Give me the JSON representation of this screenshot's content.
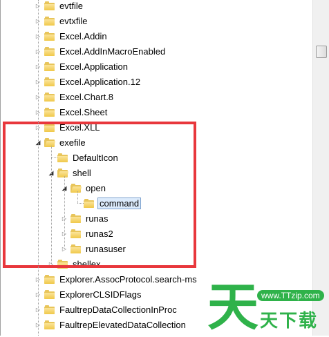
{
  "tree": {
    "items": [
      {
        "label": "evtfile",
        "level": 0,
        "state": "collapsed"
      },
      {
        "label": "evtxfile",
        "level": 0,
        "state": "collapsed"
      },
      {
        "label": "Excel.Addin",
        "level": 0,
        "state": "collapsed"
      },
      {
        "label": "Excel.AddInMacroEnabled",
        "level": 0,
        "state": "collapsed"
      },
      {
        "label": "Excel.Application",
        "level": 0,
        "state": "collapsed"
      },
      {
        "label": "Excel.Application.12",
        "level": 0,
        "state": "collapsed"
      },
      {
        "label": "Excel.Chart.8",
        "level": 0,
        "state": "collapsed"
      },
      {
        "label": "Excel.Sheet",
        "level": 0,
        "state": "collapsed"
      },
      {
        "label": "Excel.XLL",
        "level": 0,
        "state": "collapsed"
      },
      {
        "label": "exefile",
        "level": 0,
        "state": "expanded"
      },
      {
        "label": "DefaultIcon",
        "level": 1,
        "state": "leaf"
      },
      {
        "label": "shell",
        "level": 1,
        "state": "expanded"
      },
      {
        "label": "open",
        "level": 2,
        "state": "expanded"
      },
      {
        "label": "command",
        "level": 3,
        "state": "leaf",
        "selected": true
      },
      {
        "label": "runas",
        "level": 2,
        "state": "collapsed"
      },
      {
        "label": "runas2",
        "level": 2,
        "state": "collapsed"
      },
      {
        "label": "runasuser",
        "level": 2,
        "state": "collapsed"
      },
      {
        "label": "shellex",
        "level": 1,
        "state": "collapsed"
      },
      {
        "label": "Explorer.AssocProtocol.search-ms",
        "level": 0,
        "state": "collapsed"
      },
      {
        "label": "ExplorerCLSIDFlags",
        "level": 0,
        "state": "collapsed"
      },
      {
        "label": "FaultrepDataCollectionInProc",
        "level": 0,
        "state": "collapsed"
      },
      {
        "label": "FaultrepElevatedDataCollection",
        "level": 0,
        "state": "collapsed"
      }
    ]
  },
  "colors": {
    "highlight_box": "#e8373c",
    "selection_bg": "#dcebfc",
    "folder": "#f0c84a",
    "watermark": "#2fb24a"
  },
  "watermark": {
    "glyph": "天",
    "url": "www.TTzip.com",
    "text": "天下载"
  }
}
